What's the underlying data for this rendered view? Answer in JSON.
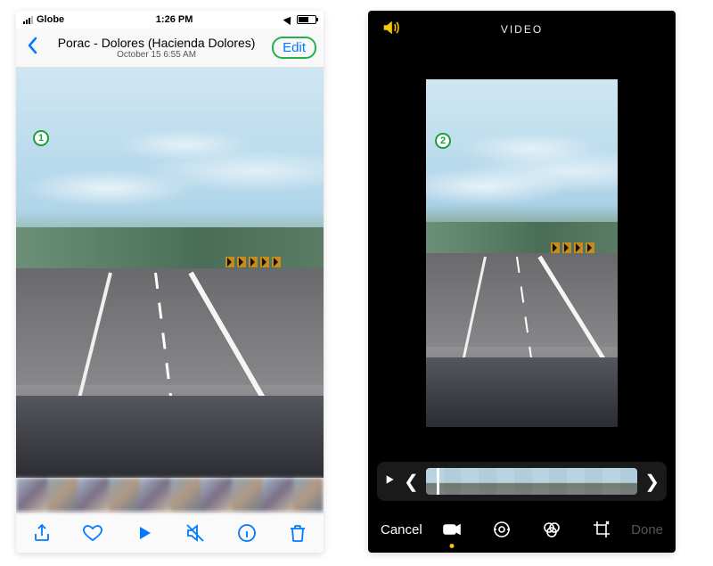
{
  "left": {
    "status": {
      "carrier": "Globe",
      "time": "1:26 PM"
    },
    "nav": {
      "title": "Porac - Dolores (Hacienda Dolores)",
      "subtitle": "October 15  6:55 AM",
      "edit_label": "Edit"
    },
    "callout": "1",
    "toolbar": {
      "share": "share-icon",
      "favorite": "heart-icon",
      "play": "play-icon",
      "mute": "mute-icon",
      "info": "info-icon",
      "trash": "trash-icon"
    }
  },
  "right": {
    "header": {
      "title": "VIDEO"
    },
    "callout": "2",
    "scrubber": {
      "play": "play"
    },
    "bottom": {
      "cancel": "Cancel",
      "done": "Done"
    },
    "tools": {
      "video": "video-icon",
      "adjust": "adjust-icon",
      "filters": "filters-icon",
      "crop": "crop-icon"
    }
  }
}
